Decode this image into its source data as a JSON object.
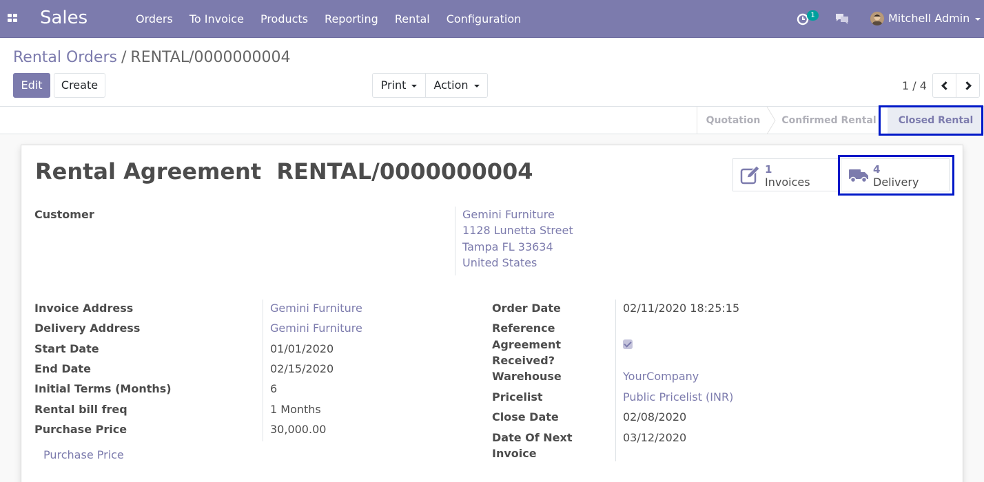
{
  "navbar": {
    "app_name": "Sales",
    "menu": [
      "Orders",
      "To Invoice",
      "Products",
      "Reporting",
      "Rental",
      "Configuration"
    ],
    "activity_count": "1",
    "user_name": "Mitchell Admin",
    "brand_color": "#7c7bad"
  },
  "control_panel": {
    "breadcrumb_parent": "Rental Orders",
    "breadcrumb_separator": "/",
    "breadcrumb_current": "RENTAL/0000000004",
    "edit_label": "Edit",
    "create_label": "Create",
    "print_label": "Print",
    "action_label": "Action",
    "pager_value": "1 / 4"
  },
  "statusbar": {
    "stages": [
      "Quotation",
      "Confirmed Rental",
      "Closed Rental"
    ],
    "active_stage": "Closed Rental"
  },
  "sheet": {
    "title_prefix": "Rental Agreement",
    "title_ref": "RENTAL/0000000004",
    "stat_buttons": [
      {
        "value": "1",
        "label": "Invoices",
        "icon": "edit-icon"
      },
      {
        "value": "4",
        "label": "Delivery",
        "icon": "truck-icon"
      }
    ],
    "customer_label": "Customer",
    "customer_address": [
      "Gemini Furniture",
      "1128 Lunetta Street",
      "Tampa FL 33634",
      "United States"
    ],
    "left_fields": [
      {
        "label": "Invoice Address",
        "value": "Gemini Furniture",
        "link": true
      },
      {
        "label": "Delivery Address",
        "value": "Gemini Furniture",
        "link": true
      },
      {
        "label": "Start Date",
        "value": "01/01/2020",
        "link": false
      },
      {
        "label": "End Date",
        "value": "02/15/2020",
        "link": false
      },
      {
        "label": "Initial Terms (Months)",
        "value": "6",
        "link": false
      },
      {
        "label": "Rental bill freq",
        "value": "1 Months",
        "link": false
      },
      {
        "label": "Purchase Price",
        "value": "30,000.00",
        "link": false
      }
    ],
    "purchase_price_link": "Purchase Price",
    "right_fields": {
      "order_date_label": "Order Date",
      "order_date": "02/11/2020 18:25:15",
      "reference_label": "Reference",
      "agreement_label_1": "Agreement",
      "agreement_label_2": "Received?",
      "agreement_received": true,
      "warehouse_label": "Warehouse",
      "warehouse": "YourCompany",
      "pricelist_label": "Pricelist",
      "pricelist": "Public Pricelist (INR)",
      "close_date_label": "Close Date",
      "close_date": "02/08/2020",
      "next_invoice_label_1": "Date Of Next",
      "next_invoice_label_2": "Invoice",
      "next_invoice_date": "03/12/2020"
    }
  }
}
